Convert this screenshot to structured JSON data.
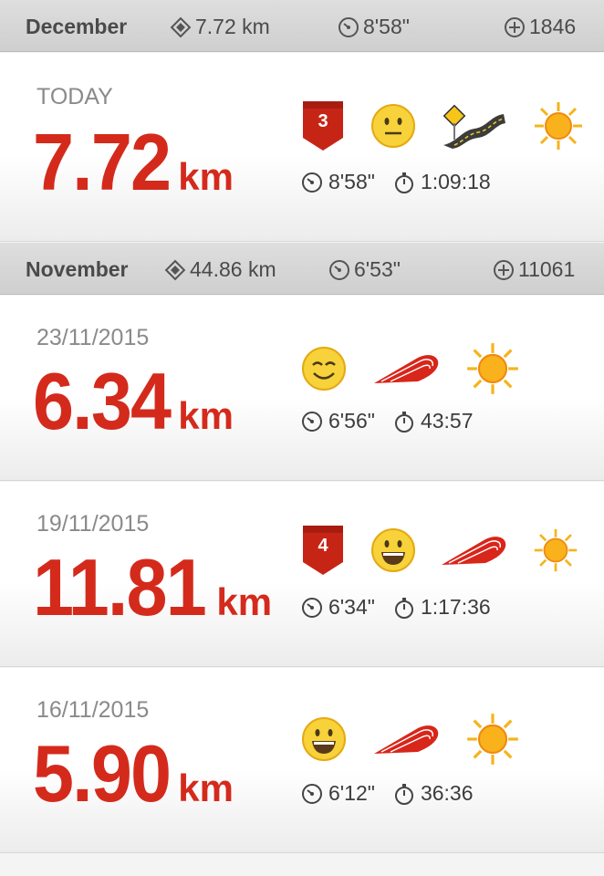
{
  "months": [
    {
      "name": "December",
      "distance": "7.72 km",
      "pace": "8'58\"",
      "calories": "1846"
    },
    {
      "name": "November",
      "distance": "44.86 km",
      "pace": "6'53\"",
      "calories": "11061"
    }
  ],
  "runs": [
    {
      "date": "TODAY",
      "distance": "7.72",
      "unit": "km",
      "pace": "8'58\"",
      "duration": "1:09:18",
      "badge": "3",
      "mood": "neutral-face-icon",
      "route": "winding-road-icon",
      "weather": "sun-icon"
    },
    {
      "date": "23/11/2015",
      "distance": "6.34",
      "unit": "km",
      "pace": "6'56\"",
      "duration": "43:57",
      "mood": "smiling-face-icon",
      "route": "track-icon",
      "weather": "sun-icon"
    },
    {
      "date": "19/11/2015",
      "distance": "11.81",
      "unit": "km",
      "pace": "6'34\"",
      "duration": "1:17:36",
      "badge": "4",
      "mood": "grinning-face-icon",
      "route": "track-icon",
      "weather": "sun-icon"
    },
    {
      "date": "16/11/2015",
      "distance": "5.90",
      "unit": "km",
      "pace": "6'12\"",
      "duration": "36:36",
      "mood": "grinning-face-icon",
      "route": "track-icon",
      "weather": "sun-icon"
    }
  ],
  "colors": {
    "accent": "#d42a1c",
    "header": "#d6d6d6"
  }
}
